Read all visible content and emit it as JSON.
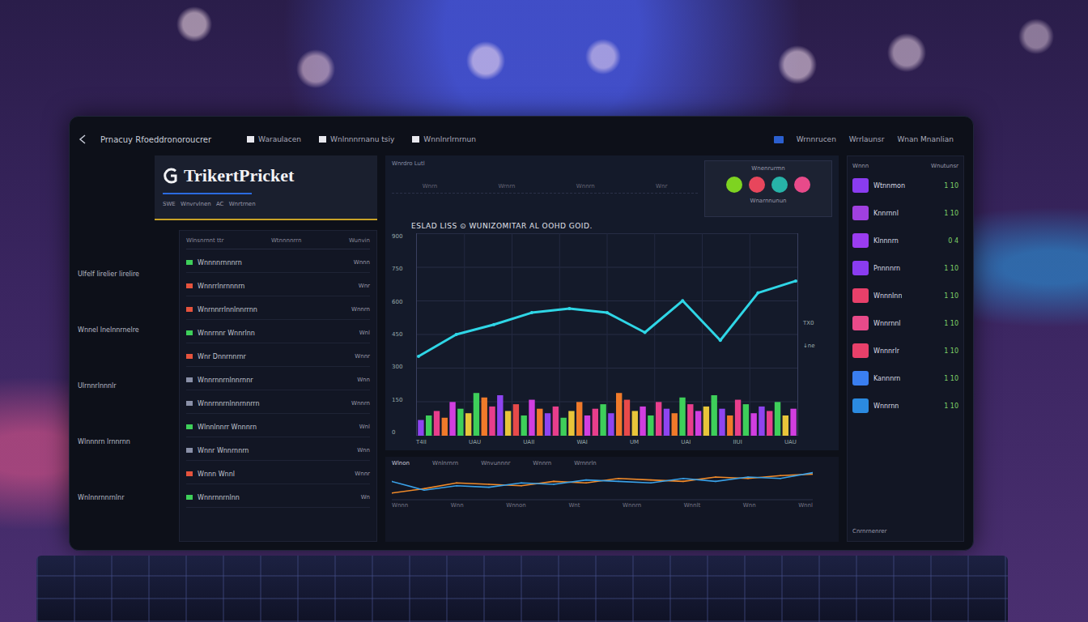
{
  "header": {
    "title": "Prnacuy Rfoeddronoroucrer",
    "nav": [
      "Waraulacen",
      "Wnlnnnrnanu tsiy",
      "Wnnlnrlrnrnun"
    ],
    "actions": [
      "Wrnnrucen",
      "Wrrlaunsr",
      "Wnan Mnanlian"
    ]
  },
  "logo": {
    "name": "TrikertPricket",
    "tagline": "SWE Wnvrvlnen AC Wnrtrnen"
  },
  "side_labels": [
    "Ulfelf lirelier lirelire",
    "Wnnel lnelnnrnelre",
    "Ulrnnrlnnnlr",
    "Wlnnnrn lrnnrnn",
    "Wnlnnrnnrnlnr"
  ],
  "list": {
    "columns": [
      "Wlnsnrnnt ttr",
      "Wtnnnnrrn",
      "Wunvin"
    ],
    "rows": [
      {
        "text": "Wnnnnrnnnrn",
        "value": "Wnnn",
        "color": "#3ecf5a"
      },
      {
        "text": "Wnnrrlnrnnnrn",
        "value": "Wnr",
        "color": "#e5533d"
      },
      {
        "text": "Wnrnnrrlnnlnnrrnn",
        "value": "Wnnrn",
        "color": "#e5533d"
      },
      {
        "text": "Wnnrnnr Wnnrlnn",
        "value": "Wnl",
        "color": "#3ecf5a"
      },
      {
        "text": "Wnr Dnnrnnrnr",
        "value": "Wnnr",
        "color": "#e5533d"
      },
      {
        "text": "Wnnrnnrnlnnrnnr",
        "value": "Wnn",
        "color": "#8a90a8"
      },
      {
        "text": "Wnnrnnrnlnnrnnrrn",
        "value": "Wnnrn",
        "color": "#8a90a8"
      },
      {
        "text": "Wlnnlnnrr Wnnnrn",
        "value": "Wnl",
        "color": "#3ecf5a"
      },
      {
        "text": "Wnnr Wnnrnnrn",
        "value": "Wnn",
        "color": "#8a90a8"
      },
      {
        "text": "Wnnn Wnnl",
        "value": "Wnnr",
        "color": "#e5533d"
      },
      {
        "text": "Wnnrnnrnlnn",
        "value": "Wn",
        "color": "#3ecf5a"
      }
    ]
  },
  "chart": {
    "label": "Wnrdro Lutl",
    "top_ticks": [
      "Wnrn",
      "Wrnrn",
      "Wnnrn",
      "Wnr"
    ],
    "title": "ESLAD LISS ⊙ WUNIZOMITAR AL OOHD GOID.",
    "y_ticks": [
      "900",
      "750",
      "600",
      "450",
      "300",
      "150",
      "0"
    ],
    "x_ticks": [
      "T4II",
      "UAU",
      "UAII",
      "WAI",
      "UM",
      "UAI",
      "IIUI",
      "UAU"
    ],
    "right_tick": "TX0",
    "right_note": "↓ne",
    "line": [
      353,
      450,
      494,
      547,
      565,
      547,
      459,
      600,
      424,
      635,
      688
    ],
    "bars": [
      {
        "value": 70,
        "color": "#8e44f0"
      },
      {
        "value": 90,
        "color": "#3ecf5a"
      },
      {
        "value": 110,
        "color": "#e83e8c"
      },
      {
        "value": 80,
        "color": "#f07a2a"
      },
      {
        "value": 150,
        "color": "#d13ee0"
      },
      {
        "value": 120,
        "color": "#3ecf5a"
      },
      {
        "value": 100,
        "color": "#e8c53a"
      },
      {
        "value": 190,
        "color": "#3ecf5a"
      },
      {
        "value": 170,
        "color": "#f07a2a"
      },
      {
        "value": 130,
        "color": "#e83e8c"
      },
      {
        "value": 180,
        "color": "#8e44f0"
      },
      {
        "value": 110,
        "color": "#e8c53a"
      },
      {
        "value": 140,
        "color": "#e84a4a"
      },
      {
        "value": 90,
        "color": "#3ecf5a"
      },
      {
        "value": 160,
        "color": "#d13ee0"
      },
      {
        "value": 120,
        "color": "#f07a2a"
      },
      {
        "value": 100,
        "color": "#8e44f0"
      },
      {
        "value": 130,
        "color": "#e83e8c"
      },
      {
        "value": 80,
        "color": "#3ecf5a"
      },
      {
        "value": 110,
        "color": "#e8c53a"
      },
      {
        "value": 150,
        "color": "#f07a2a"
      },
      {
        "value": 90,
        "color": "#d13ee0"
      },
      {
        "value": 120,
        "color": "#e83e8c"
      },
      {
        "value": 140,
        "color": "#3ecf5a"
      },
      {
        "value": 100,
        "color": "#8e44f0"
      },
      {
        "value": 190,
        "color": "#f07a2a"
      },
      {
        "value": 160,
        "color": "#e84a4a"
      },
      {
        "value": 110,
        "color": "#e8c53a"
      },
      {
        "value": 130,
        "color": "#d13ee0"
      },
      {
        "value": 90,
        "color": "#3ecf5a"
      },
      {
        "value": 150,
        "color": "#e83e8c"
      },
      {
        "value": 120,
        "color": "#8e44f0"
      },
      {
        "value": 100,
        "color": "#f07a2a"
      },
      {
        "value": 170,
        "color": "#3ecf5a"
      },
      {
        "value": 140,
        "color": "#e83e8c"
      },
      {
        "value": 110,
        "color": "#d13ee0"
      },
      {
        "value": 130,
        "color": "#e8c53a"
      },
      {
        "value": 180,
        "color": "#3ecf5a"
      },
      {
        "value": 120,
        "color": "#8e44f0"
      },
      {
        "value": 90,
        "color": "#f07a2a"
      },
      {
        "value": 160,
        "color": "#e83e8c"
      },
      {
        "value": 140,
        "color": "#3ecf5a"
      },
      {
        "value": 100,
        "color": "#d13ee0"
      },
      {
        "value": 130,
        "color": "#8e44f0"
      },
      {
        "value": 110,
        "color": "#e83e8c"
      },
      {
        "value": 150,
        "color": "#3ecf5a"
      },
      {
        "value": 90,
        "color": "#e8c53a"
      },
      {
        "value": 120,
        "color": "#d13ee0"
      }
    ]
  },
  "badges": {
    "label": "Wnenrurmn",
    "items": [
      {
        "color": "#7ed321"
      },
      {
        "color": "#e8465c"
      },
      {
        "color": "#27b3a8"
      },
      {
        "color": "#e84a8a"
      }
    ],
    "footer": "Wnarnnunun"
  },
  "mini_chart": {
    "header": [
      "Wlnon",
      "Wnlnrnrn",
      "Wnvunnnr",
      "Wnnrn",
      "Wrnnrln"
    ],
    "x_ticks": [
      "Wnnn",
      "Wnn",
      "Wnnon",
      "Wnt",
      "Wnnrn",
      "Wnnlt",
      "Wnn",
      "Wnnl"
    ],
    "series": [
      {
        "values": [
          20,
          35,
          55,
          50,
          45,
          60,
          55,
          70,
          65,
          60,
          75,
          70,
          80,
          85
        ],
        "color": "#f08a2a"
      },
      {
        "values": [
          60,
          30,
          45,
          40,
          55,
          50,
          65,
          60,
          55,
          70,
          60,
          75,
          70,
          90
        ],
        "color": "#3aa0e6"
      }
    ]
  },
  "assets": {
    "header": [
      "Wnnn",
      "Wnutunsr"
    ],
    "items": [
      {
        "name": "Wtnnmon",
        "value": "1 10",
        "color": "#8a3cf0"
      },
      {
        "name": "Knnrnnl",
        "value": "1 10",
        "color": "#a040e0"
      },
      {
        "name": "Klnnnrn",
        "value": "0 4",
        "color": "#9a3cf0"
      },
      {
        "name": "Pnnnnrn",
        "value": "1 10",
        "color": "#8a3cf0"
      },
      {
        "name": "Wnnnlnn",
        "value": "1 10",
        "color": "#e8406a"
      },
      {
        "name": "Wnnrnnl",
        "value": "1 10",
        "color": "#e84a8a"
      },
      {
        "name": "Wnnnrlr",
        "value": "1 10",
        "color": "#e8406a"
      },
      {
        "name": "Kannnrn",
        "value": "1 10",
        "color": "#3a7ef0"
      },
      {
        "name": "Wnnrnn",
        "value": "1 10",
        "color": "#2b8ae0"
      }
    ],
    "footer": "Cnrnrnenrer"
  }
}
